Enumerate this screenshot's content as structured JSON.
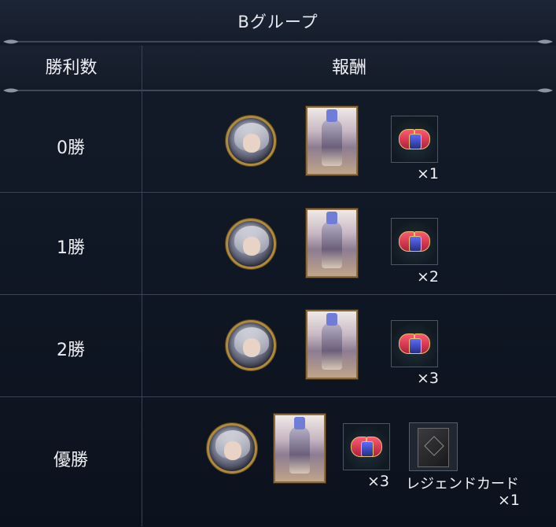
{
  "title": "Bグループ",
  "headers": {
    "wins": "勝利数",
    "rewards": "報酬"
  },
  "rows": [
    {
      "label": "0勝",
      "item_qty": "×1"
    },
    {
      "label": "1勝",
      "item_qty": "×2"
    },
    {
      "label": "2勝",
      "item_qty": "×3"
    },
    {
      "label": "優勝",
      "item_qty": "×3",
      "legend_label": "レジェンドカード",
      "legend_qty": "×1"
    }
  ],
  "icons": {
    "coin": "character-coin-icon",
    "card": "character-card-icon",
    "item": "axe-emblem-item-icon",
    "legend": "legend-card-icon"
  },
  "colors": {
    "background": "#0d1420",
    "divider": "#3a4354",
    "gold": "#b08a3a"
  }
}
